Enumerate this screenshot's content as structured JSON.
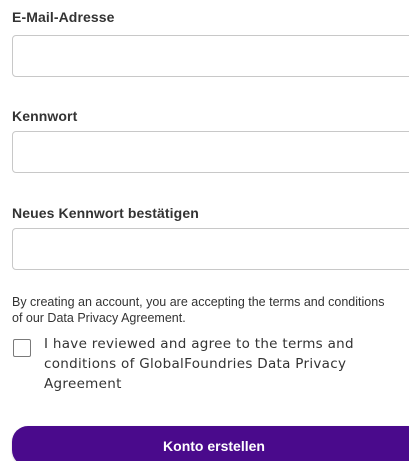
{
  "form": {
    "email": {
      "label": "E-Mail-Adresse",
      "value": "",
      "placeholder": ""
    },
    "password": {
      "label": "Kennwort",
      "value": "",
      "placeholder": ""
    },
    "confirm_password": {
      "label": "Neues Kennwort bestätigen",
      "value": "",
      "placeholder": ""
    },
    "terms_notice": "By creating an account, you are accepting the terms and conditions of our Data Privacy Agreement.",
    "agree_checkbox": {
      "label": "I have reviewed and agree to the terms and conditions of GlobalFoundries Data Privacy Agreement",
      "checked": false
    },
    "submit_label": "Konto erstellen"
  },
  "colors": {
    "button_bg": "#4a0a8c",
    "button_text": "#ffffff",
    "input_border": "#c8c8c8"
  }
}
